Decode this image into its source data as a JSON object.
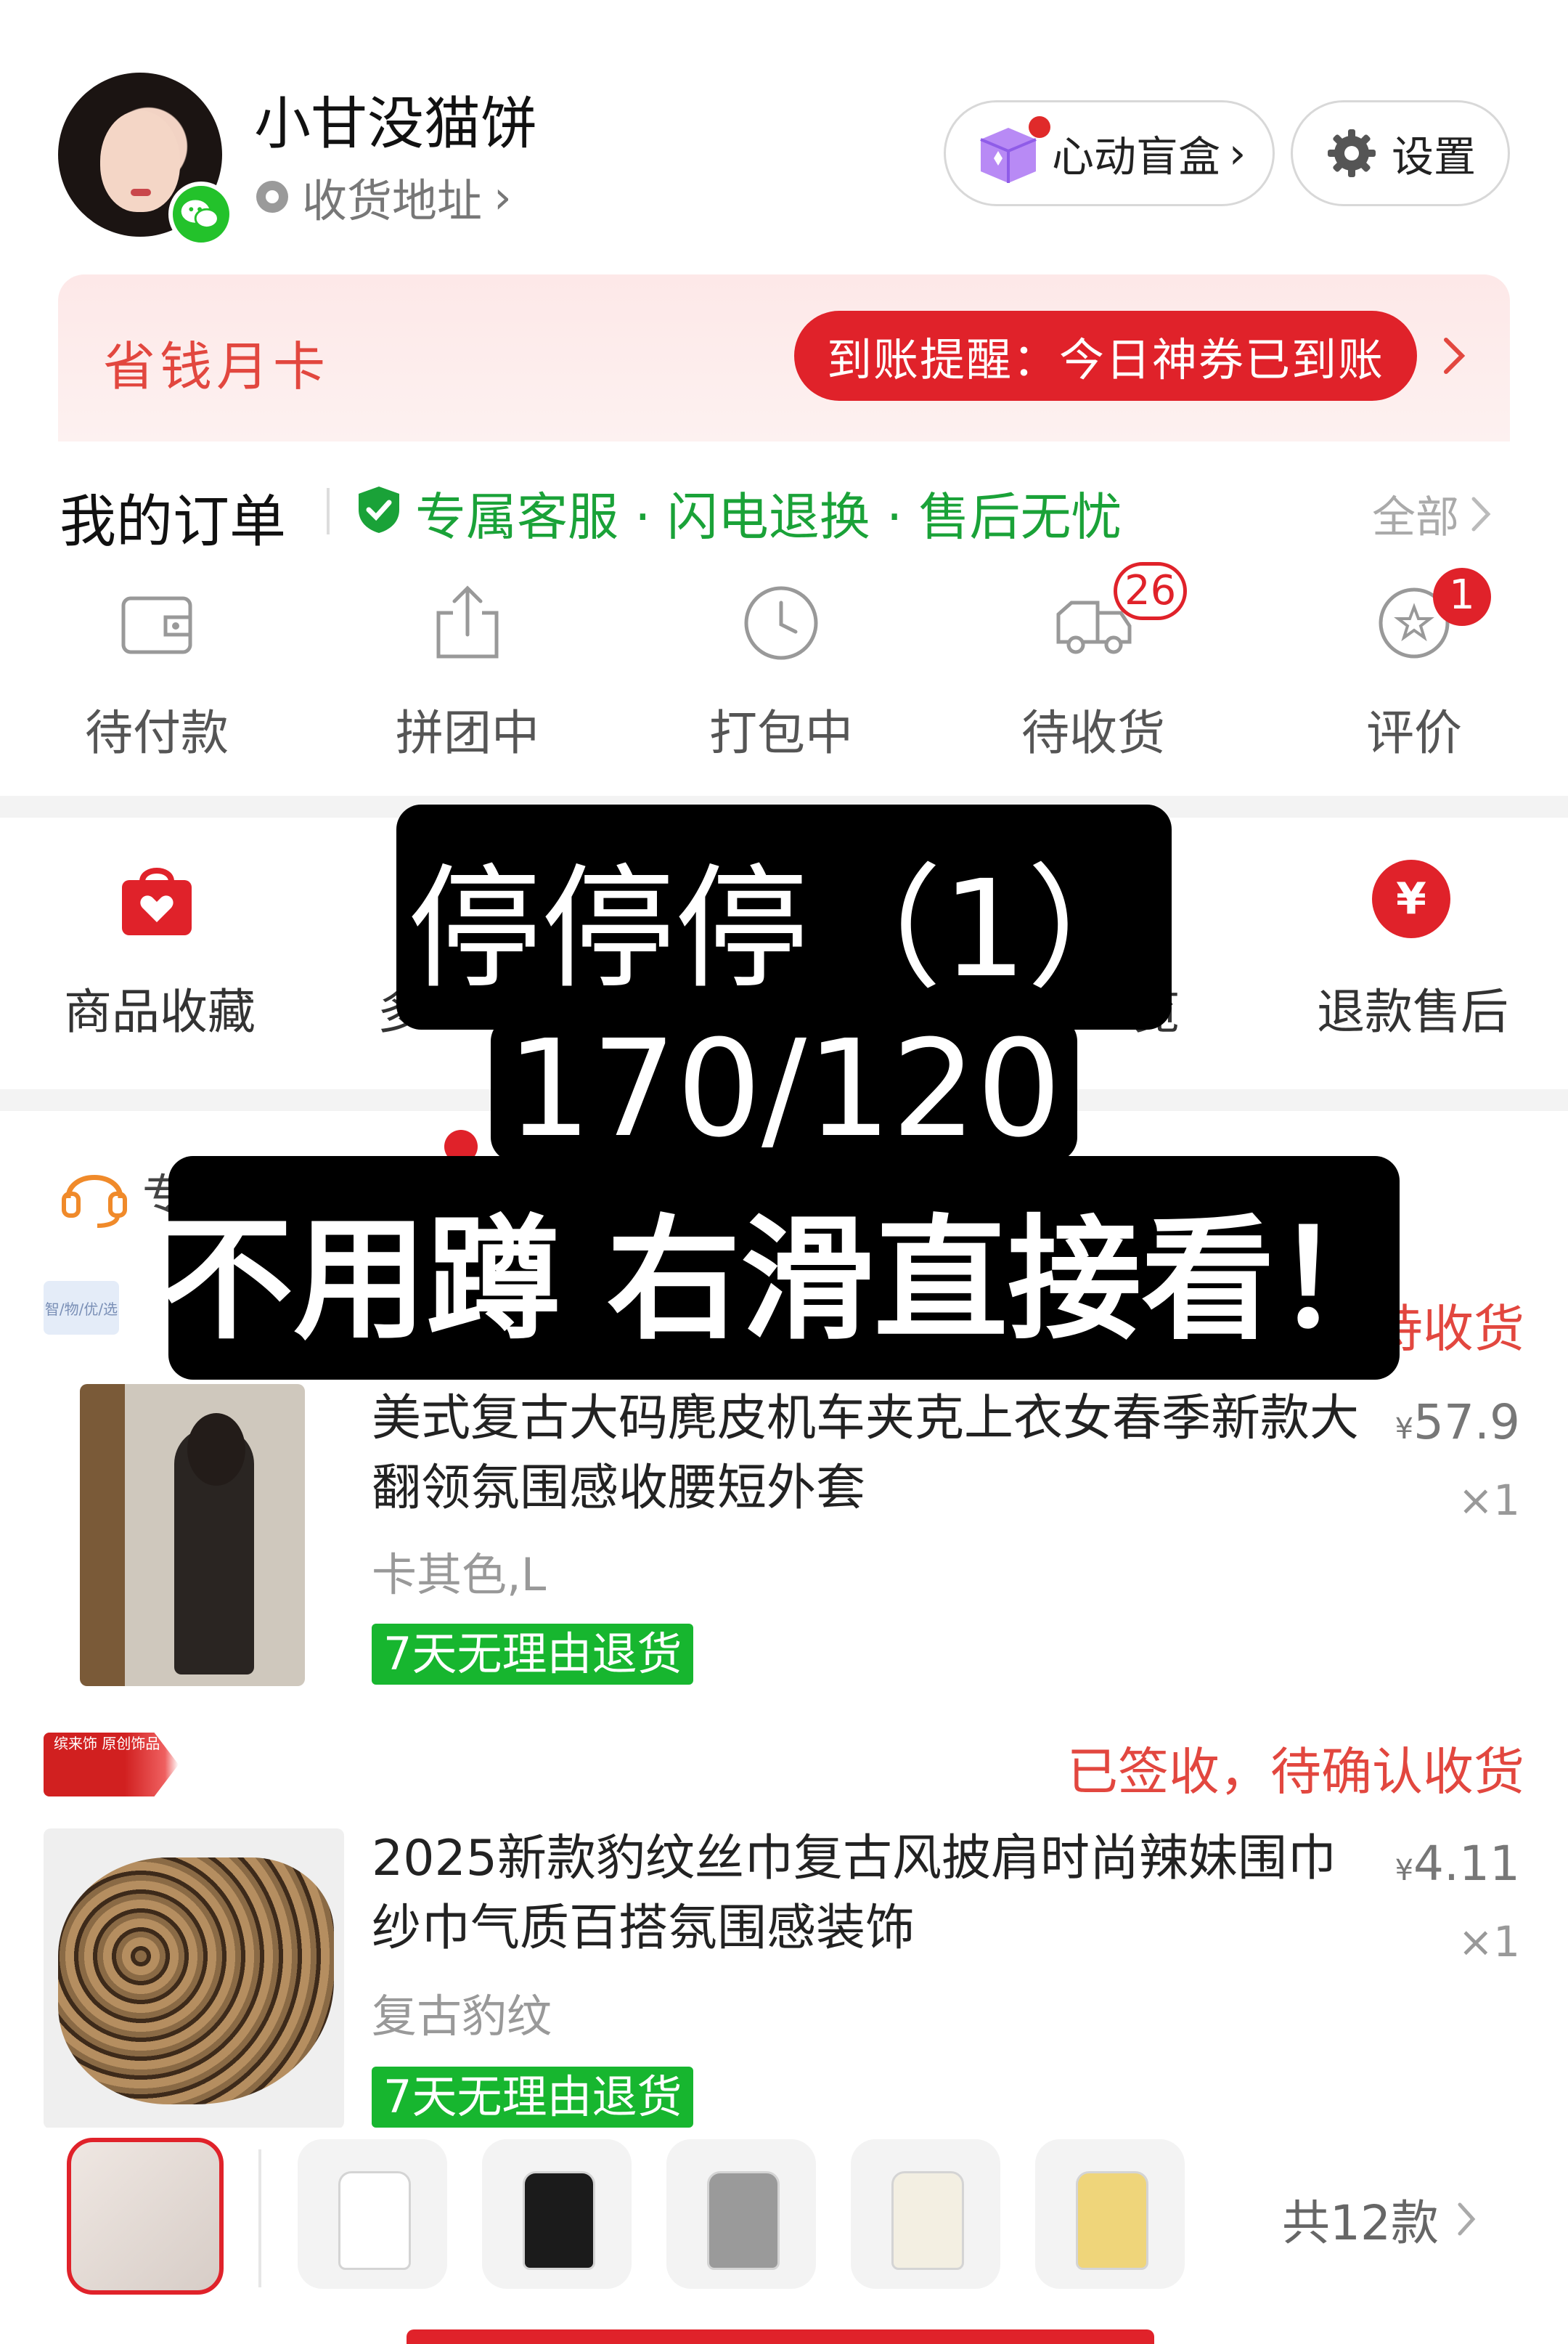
{
  "header": {
    "username": "小甘没猫饼",
    "address_label": "收货地址",
    "address_chevron": "›",
    "blindbox_label": "心动盲盒",
    "blindbox_chevron": "›",
    "settings_label": "设置"
  },
  "savings_card": {
    "title": "省钱月卡",
    "reminder": "到账提醒：今日神券已到账",
    "chevron": "›"
  },
  "orders": {
    "title": "我的订单",
    "service_text": "专属客服 · 闪电退换 · 售后无忧",
    "all_label": "全部",
    "items": [
      {
        "label": "待付款",
        "icon": "wallet-icon"
      },
      {
        "label": "拼团中",
        "icon": "share-icon"
      },
      {
        "label": "打包中",
        "icon": "clock-icon"
      },
      {
        "label": "待收货",
        "icon": "truck-icon",
        "badge": "26"
      },
      {
        "label": "评价",
        "icon": "star-comment-icon",
        "badge": "1"
      }
    ]
  },
  "shortcuts": {
    "favorites": "商品收藏",
    "partial_left": "多",
    "partial_right": "览",
    "refund": "退款售后",
    "refund_symbol": "¥"
  },
  "service_row": {
    "partial_text": "专"
  },
  "order_list": [
    {
      "shop_logo_text": "智/物/优/选",
      "status": "待收货",
      "name": "美式复古大码麂皮机车夹克上衣女春季新款大翻领氛围感收腰短外套",
      "spec": "卡其色,L",
      "tag": "7天无理由退货",
      "price_symbol": "¥",
      "price": "57.9",
      "qty": "×1"
    },
    {
      "shop_logo_text": "缤来饰 原创饰品",
      "status": "已签收，待确认收货",
      "name": "2025新款豹纹丝巾复古风披肩时尚辣妹围巾纱巾气质百搭氛围感装饰",
      "spec": "复古豹纹",
      "tag": "7天无理由退货",
      "price_symbol": "¥",
      "price": "4.11",
      "qty": "×1"
    }
  ],
  "variant_strip": {
    "total_label": "共12款",
    "colors": [
      "#ffffff",
      "#1b1b1b",
      "#9a9a9a",
      "#f3efe2",
      "#efd57a"
    ]
  },
  "overlay": {
    "line1": "停停停（1）",
    "line2": "170/120",
    "line3": "不用蹲 右滑直接看！"
  },
  "colors": {
    "accent_red": "#e0222a",
    "service_green": "#1aa238",
    "tag_green": "#17b62f"
  }
}
